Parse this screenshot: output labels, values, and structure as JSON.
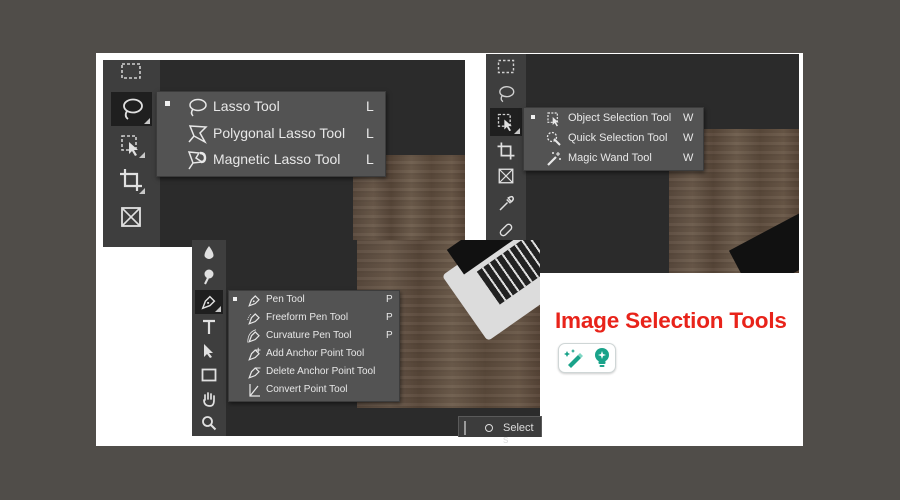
{
  "lasso_menu": {
    "items": [
      {
        "label": "Lasso Tool",
        "shortcut": "L",
        "icon": "lasso-icon",
        "selected": true
      },
      {
        "label": "Polygonal Lasso Tool",
        "shortcut": "L",
        "icon": "polygonal-lasso-icon",
        "selected": false
      },
      {
        "label": "Magnetic Lasso Tool",
        "shortcut": "L",
        "icon": "magnetic-lasso-icon",
        "selected": false
      }
    ]
  },
  "selection_menu": {
    "items": [
      {
        "label": "Object Selection Tool",
        "shortcut": "W",
        "icon": "object-selection-icon",
        "selected": true
      },
      {
        "label": "Quick Selection Tool",
        "shortcut": "W",
        "icon": "quick-selection-icon",
        "selected": false
      },
      {
        "label": "Magic Wand Tool",
        "shortcut": "W",
        "icon": "magic-wand-icon",
        "selected": false
      }
    ]
  },
  "pen_menu": {
    "items": [
      {
        "label": "Pen Tool",
        "shortcut": "P",
        "icon": "pen-icon",
        "selected": true
      },
      {
        "label": "Freeform Pen Tool",
        "shortcut": "P",
        "icon": "freeform-pen-icon",
        "selected": false
      },
      {
        "label": "Curvature Pen Tool",
        "shortcut": "P",
        "icon": "curvature-pen-icon",
        "selected": false
      },
      {
        "label": "Add Anchor Point Tool",
        "shortcut": "",
        "icon": "add-anchor-icon",
        "selected": false
      },
      {
        "label": "Delete Anchor Point Tool",
        "shortcut": "",
        "icon": "delete-anchor-icon",
        "selected": false
      },
      {
        "label": "Convert Point Tool",
        "shortcut": "",
        "icon": "convert-point-icon",
        "selected": false
      }
    ]
  },
  "banner": {
    "title": "Image Selection Tools"
  },
  "status_tip": {
    "text": "Select s"
  },
  "colors": {
    "background": "#504d49",
    "panel": "#2b2b2b",
    "toolbar": "#434343",
    "menu": "#535353",
    "title_red": "#e8231a",
    "logo_green": "#1aa38a"
  }
}
